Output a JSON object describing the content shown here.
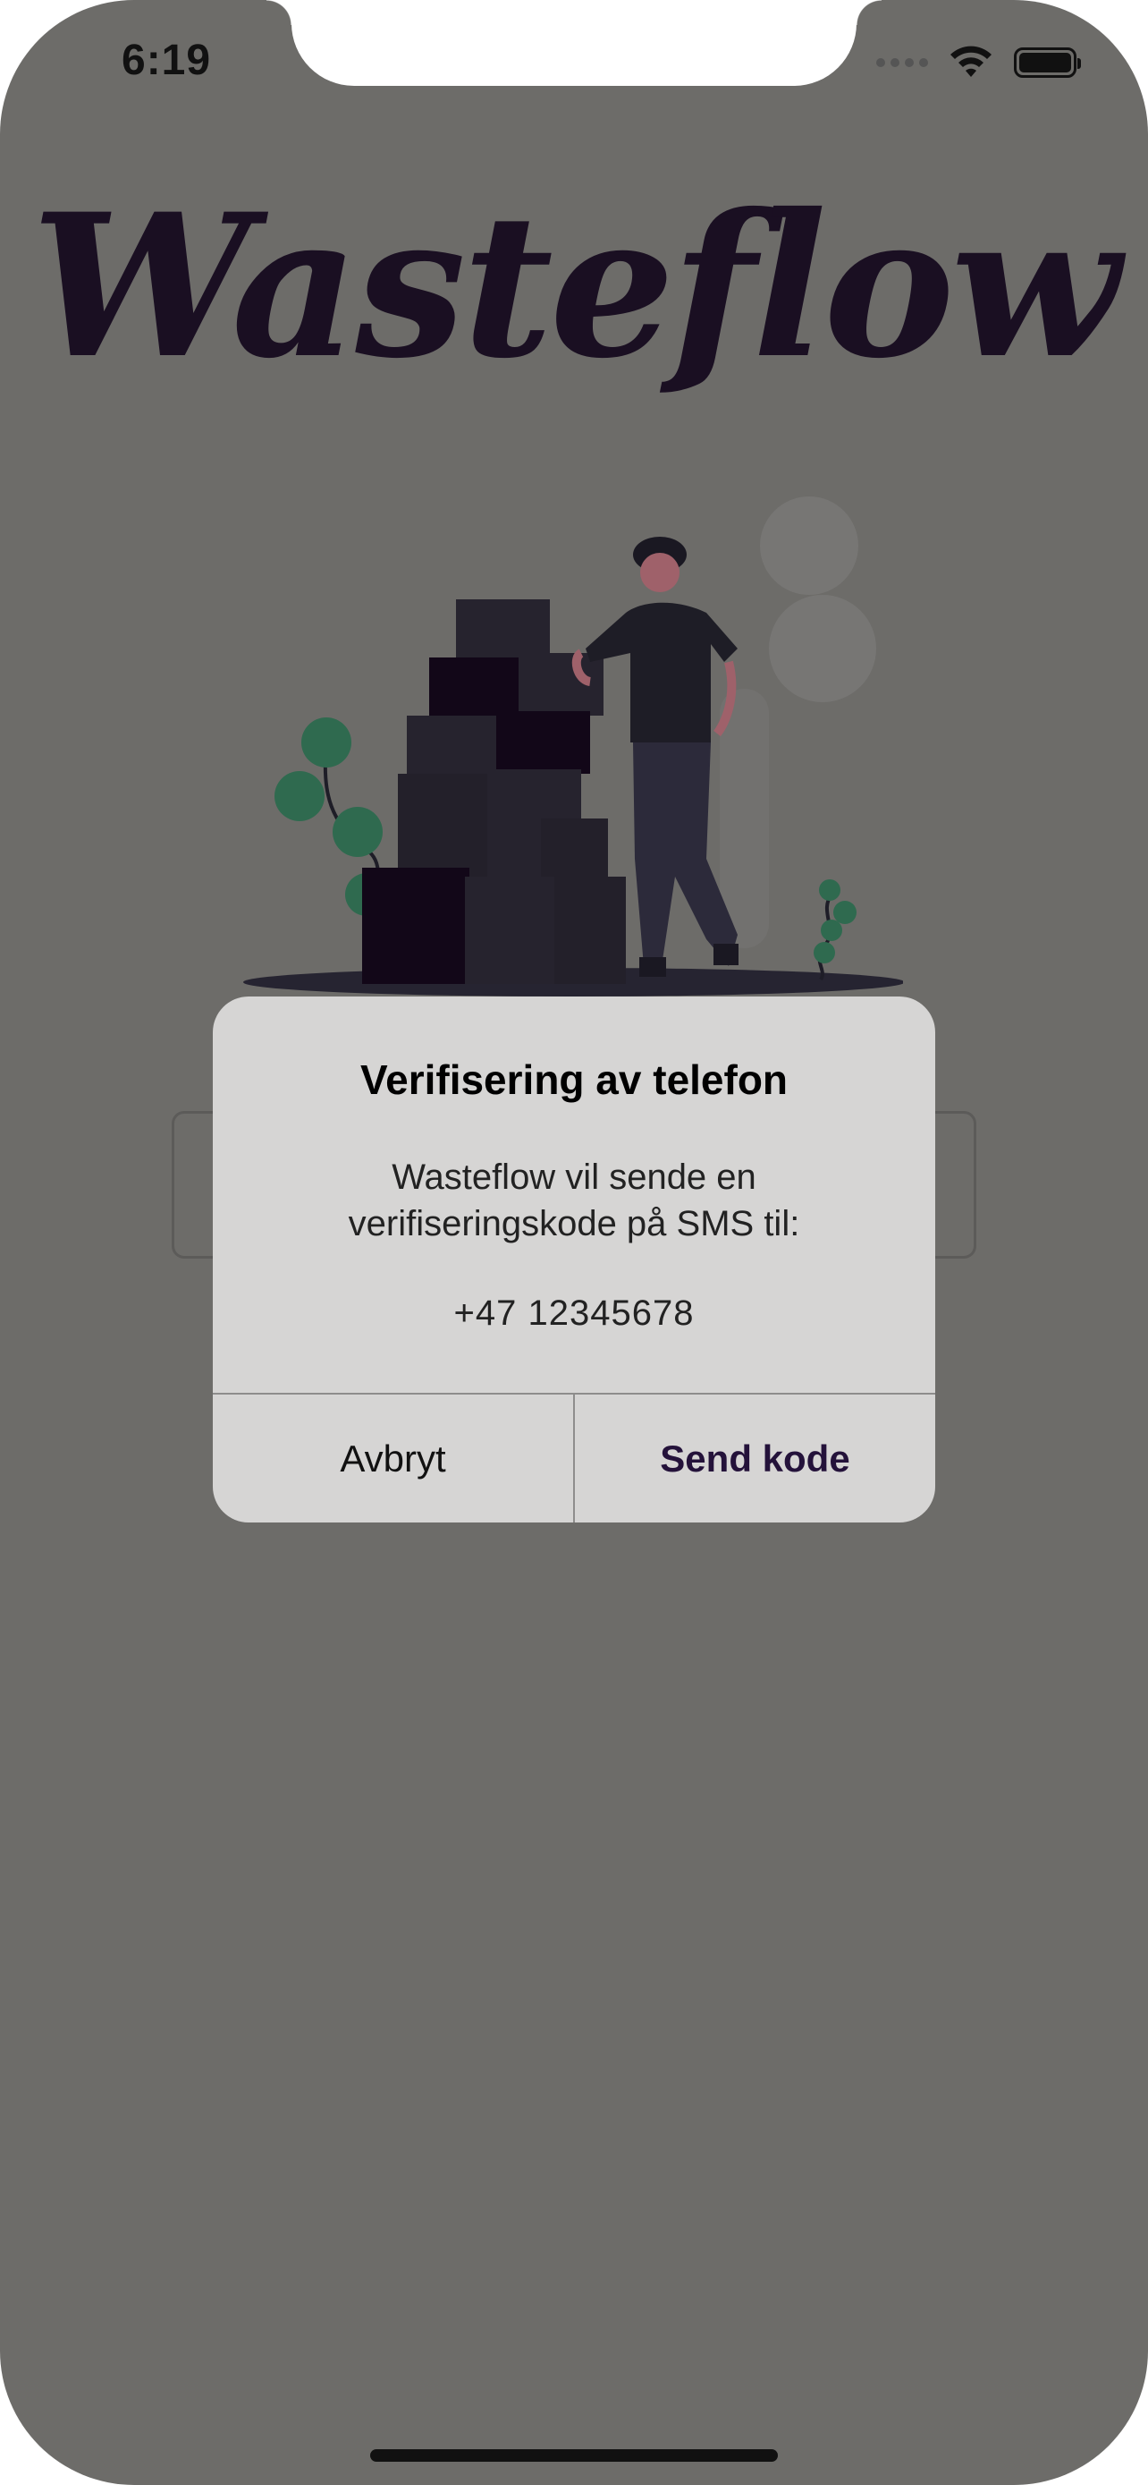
{
  "status_bar": {
    "time": "6:19",
    "icons": [
      "signal-dots-icon",
      "wifi-icon",
      "battery-icon"
    ]
  },
  "app": {
    "logo_text": "Wasteflow"
  },
  "alert": {
    "title": "Verifisering av telefon",
    "message_line1": "Wasteflow vil sende en",
    "message_line2": "verifiseringskode på SMS til:",
    "phone": "+47 12345678",
    "cancel_label": "Avbryt",
    "confirm_label": "Send kode"
  },
  "colors": {
    "background_dimmed": "#6d6c69",
    "alert_bg": "#d6d5d4",
    "accent": "#24123a",
    "plant": "#2f6a4f"
  }
}
